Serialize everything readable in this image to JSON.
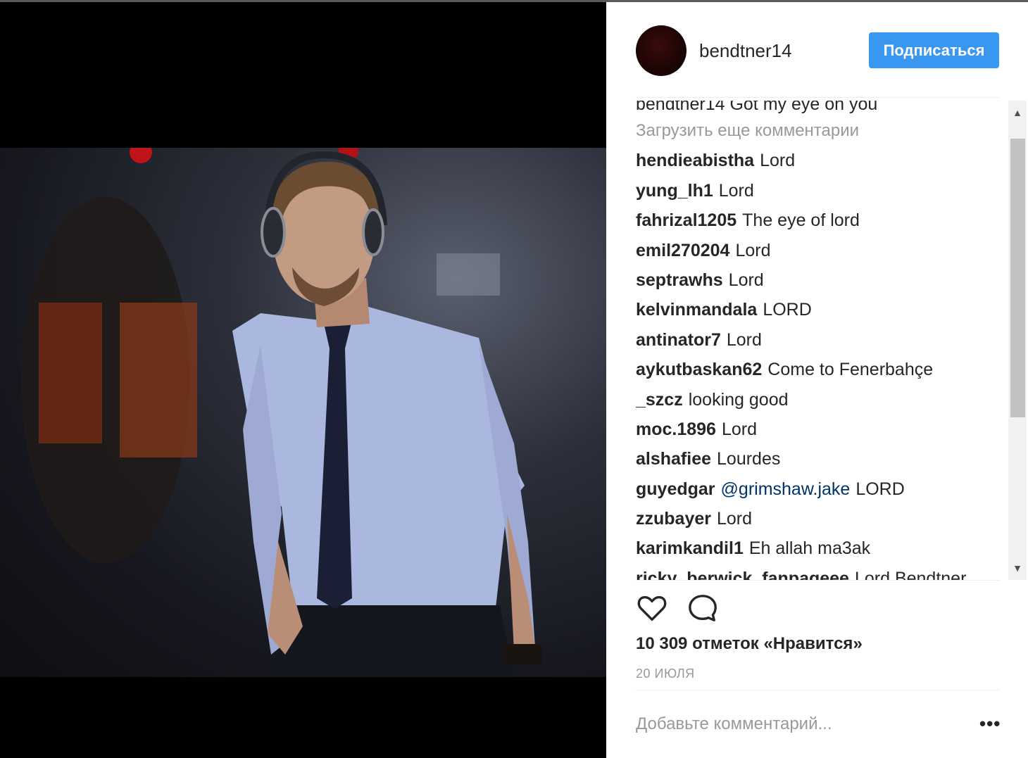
{
  "post": {
    "username": "bendtner14",
    "follow_label": "Подписаться",
    "caption_partial": "bendtner14 Got my eye on you",
    "load_more": "Загрузить еще комментарии",
    "comments": [
      {
        "user": "hendieabistha",
        "mention": "",
        "text": "Lord"
      },
      {
        "user": "yung_lh1",
        "mention": "",
        "text": "Lord"
      },
      {
        "user": "fahrizal1205",
        "mention": "",
        "text": "The eye of lord"
      },
      {
        "user": "emil270204",
        "mention": "",
        "text": "Lord"
      },
      {
        "user": "septrawhs",
        "mention": "",
        "text": "Lord"
      },
      {
        "user": "kelvinmandala",
        "mention": "",
        "text": "LORD"
      },
      {
        "user": "antinator7",
        "mention": "",
        "text": "Lord"
      },
      {
        "user": "aykutbaskan62",
        "mention": "",
        "text": "Come to Fenerbahçe"
      },
      {
        "user": "_szcz",
        "mention": "",
        "text": "looking good"
      },
      {
        "user": "moc.1896",
        "mention": "",
        "text": "Lord"
      },
      {
        "user": "alshafiee",
        "mention": "",
        "text": "Lourdes"
      },
      {
        "user": "guyedgar",
        "mention": "@grimshaw.jake",
        "text": "LORD"
      },
      {
        "user": "zzubayer",
        "mention": "",
        "text": "Lord"
      },
      {
        "user": "karimkandil1",
        "mention": "",
        "text": "Eh allah ma3ak"
      },
      {
        "user": "ricky_berwick_fanpageee",
        "mention": "",
        "text": "Lord Bendtner"
      }
    ],
    "likes_text": "10 309 отметок «Нравится»",
    "date": "20 ИЮЛЯ",
    "comment_placeholder": "Добавьте комментарий...",
    "more_label": "•••"
  },
  "icons": {
    "like": "heart-icon",
    "comment": "comment-bubble-icon",
    "scroll_up": "arrow-up-icon",
    "scroll_down": "arrow-down-icon"
  },
  "colors": {
    "follow_button": "#3897f0",
    "mention": "#003569",
    "text": "#262626",
    "muted": "#999999"
  }
}
